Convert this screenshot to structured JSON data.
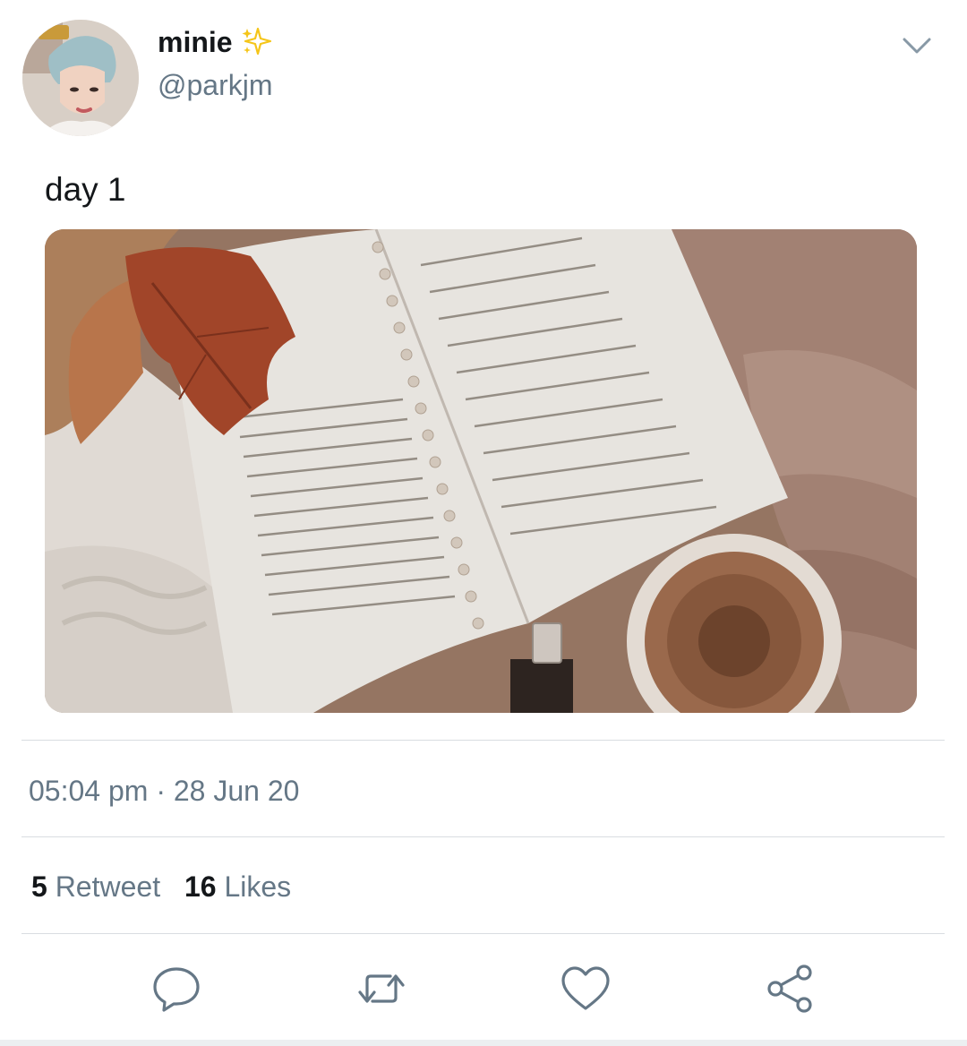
{
  "tweet": {
    "display_name": "minie",
    "name_emoji": "sparkles-icon",
    "handle": "@parkjm",
    "text": "day 1",
    "media_alt": "",
    "time": "05:04 pm",
    "separator": "·",
    "date": "28 Jun 20",
    "retweet_count": "5",
    "retweet_label": "Retweet",
    "like_count": "16",
    "like_label": "Likes"
  },
  "actions": [
    {
      "icon": "reply-icon"
    },
    {
      "icon": "retweet-icon"
    },
    {
      "icon": "like-icon"
    },
    {
      "icon": "share-icon"
    }
  ],
  "colors": {
    "text_primary": "#14171a",
    "text_secondary": "#657786",
    "divider": "#d9dde1",
    "sparkle": "#f5c518"
  }
}
